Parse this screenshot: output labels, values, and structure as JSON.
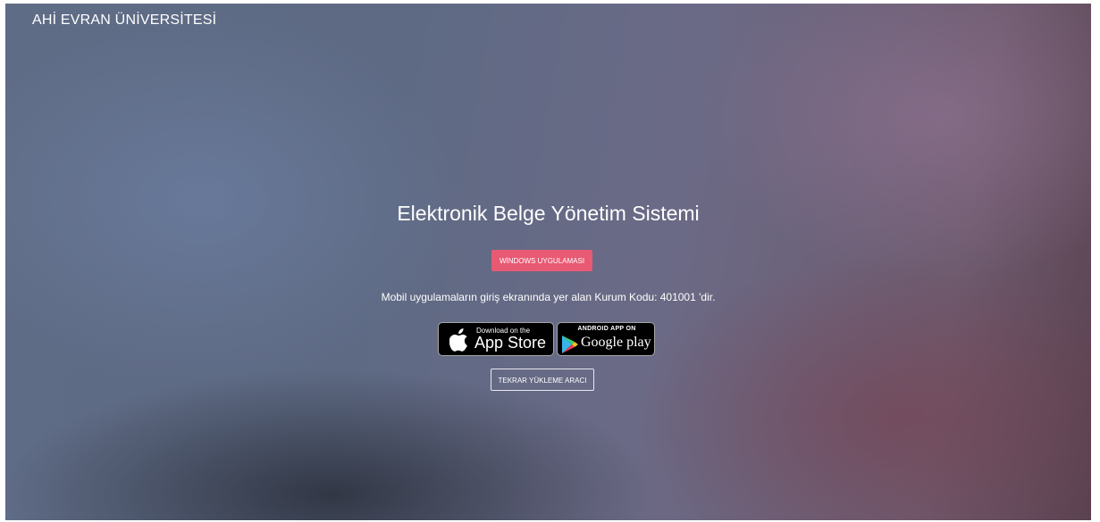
{
  "header": {
    "brand": "AHİ EVRAN ÜNİVERSİTESİ"
  },
  "main": {
    "title": "Elektronik Belge Yönetim Sistemi",
    "windows_button": "WİNDOWS UYGULAMASI",
    "info_text": "Mobil uygulamaların giriş ekranında yer alan Kurum Kodu: 401001 'dir.",
    "reload_button": "TEKRAR YÜKLEME ARACI"
  },
  "stores": {
    "appstore": {
      "small_text": "Download on the",
      "big_text": "App Store",
      "icon": "apple-icon"
    },
    "googleplay": {
      "small_text": "ANDROID APP ON",
      "big_text": "Google play",
      "icon": "google-play-icon"
    }
  },
  "colors": {
    "accent": "#e85a73"
  }
}
